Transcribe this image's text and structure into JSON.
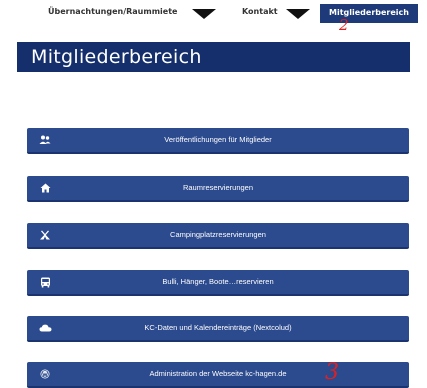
{
  "nav": {
    "items": [
      {
        "label": "Übernachtungen/Raummiete"
      },
      {
        "label": "Kontakt"
      }
    ],
    "active_label": "Mitgliederbereich"
  },
  "annotations": {
    "nav": "2",
    "admin": "3"
  },
  "page": {
    "title": "Mitgliederbereich"
  },
  "buttons": [
    {
      "label": "Veröffentlichungen für Mitglieder",
      "icon": "users-icon"
    },
    {
      "label": "Raumreservierungen",
      "icon": "home-icon"
    },
    {
      "label": "Campingplatzreservierungen",
      "icon": "tent-icon"
    },
    {
      "label": "Bulli, Hänger, Boote…reservieren",
      "icon": "bus-icon"
    },
    {
      "label": "KC-Daten und Kalendereinträge (Nextcolud)",
      "icon": "cloud-icon"
    },
    {
      "label": "Administration der Webseite kc-hagen.de",
      "icon": "wordpress-icon"
    }
  ],
  "colors": {
    "banner": "#142f6b",
    "button": "#2c4a8e",
    "active_tab": "#1f3a78",
    "annotation": "#e02020"
  }
}
